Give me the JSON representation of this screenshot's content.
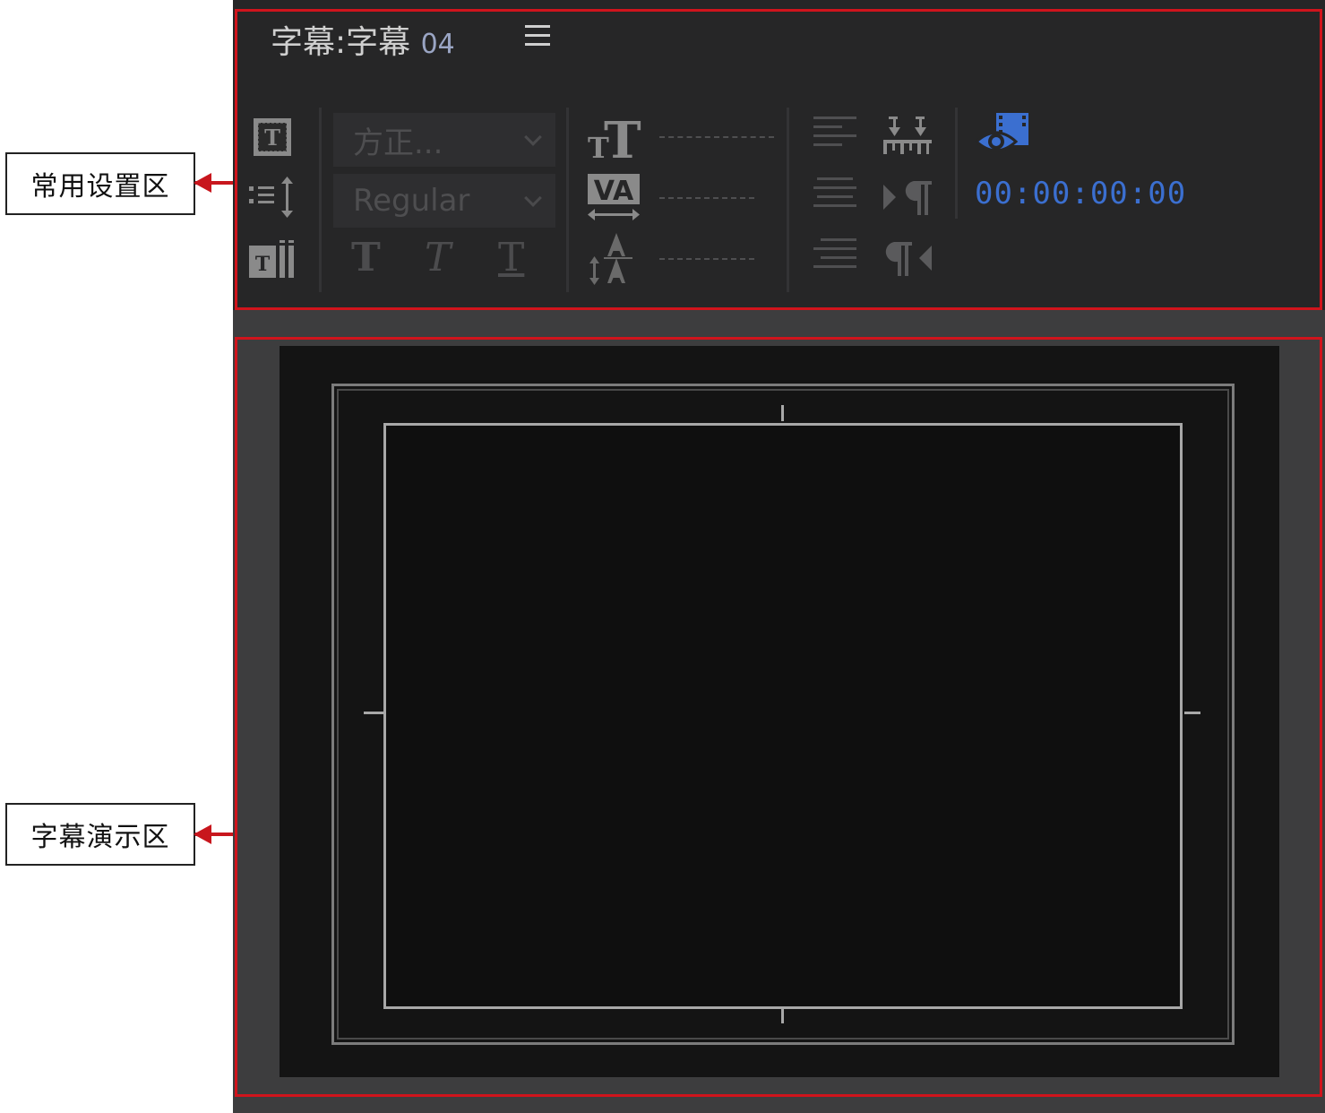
{
  "annotations": {
    "settings_area": "常用设置区",
    "preview_area": "字幕演示区"
  },
  "panel": {
    "title_prefix": "字幕:字幕",
    "title_number": "04"
  },
  "font": {
    "family_value": "方正...",
    "style_value": "Regular"
  },
  "style_buttons": {
    "bold": "T",
    "italic": "T",
    "underline": "T"
  },
  "timecode": "00:00:00:00",
  "colors": {
    "accent_blue": "#3b6fd0",
    "annotation_red": "#d0141c",
    "panel_bg": "#262627",
    "preview_bg": "#141414"
  },
  "icons": [
    "text-frame-icon",
    "line-spacing-icon",
    "text-columns-icon",
    "font-size-icon",
    "kerning-icon",
    "leading-icon",
    "align-left-icon",
    "align-center-icon",
    "align-right-icon",
    "tab-stops-icon",
    "ltr-paragraph-icon",
    "rtl-paragraph-icon",
    "show-video-icon",
    "hamburger-menu-icon"
  ]
}
